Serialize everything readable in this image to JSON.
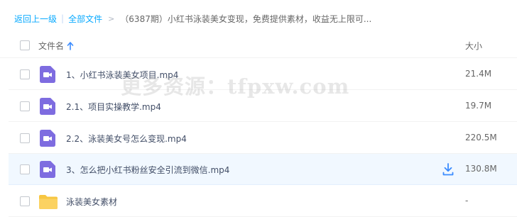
{
  "breadcrumb": {
    "back": "返回上一级",
    "all_files": "全部文件",
    "separator": "|",
    "arrow": ">",
    "current": "（6387期）小红书泳装美女变现，免费提供素材，收益无上限可..."
  },
  "header": {
    "name_label": "文件名",
    "size_label": "大小",
    "sort_icon": "arrow-up-icon"
  },
  "files": [
    {
      "name": "1、小红书泳装美女项目.mp4",
      "size": "21.4M",
      "icon": "video-file-icon"
    },
    {
      "name": "2.1、项目实操教学.mp4",
      "size": "19.7M",
      "icon": "video-file-icon"
    },
    {
      "name": "2.2、泳装美女号怎么变现.mp4",
      "size": "220.5M",
      "icon": "video-file-icon"
    },
    {
      "name": "3、怎么把小红书粉丝安全引流到微信.mp4",
      "size": "130.8M",
      "icon": "video-file-icon",
      "hovered": true
    },
    {
      "name": "泳装美女素材",
      "size": "-",
      "icon": "folder-icon"
    }
  ],
  "watermark": "更多资源：tfpxw.com",
  "colors": {
    "link": "#09aaff",
    "video_icon": "#7e6ce0",
    "folder_icon": "#f7c641",
    "hover_row": "#f1f8ff",
    "download_icon": "#3b8cff"
  }
}
